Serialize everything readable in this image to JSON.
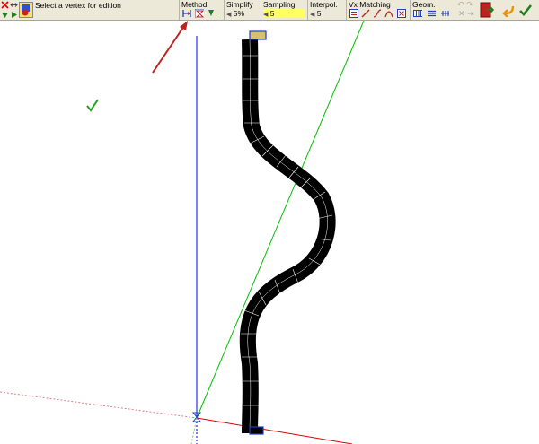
{
  "toolbar": {
    "status": "Select a vertex for edition",
    "method": {
      "title": "Method"
    },
    "simplify": {
      "title": "Simplify",
      "value": "5%"
    },
    "sampling": {
      "title": "Sampling",
      "value": "5"
    },
    "interpol": {
      "title": "Interpol.",
      "value": "5"
    },
    "vx_matching": {
      "title": "Vx Matching"
    },
    "geom": {
      "title": "Geom."
    }
  },
  "colors": {
    "toolbar_bg": "#ece9d8",
    "sampling_highlight": "#ffff66",
    "axis_blue": "#0000ff",
    "axis_green": "#00c000",
    "axis_red": "#e00000",
    "shape_fill": "#000000",
    "arrow_red": "#c02020",
    "check_green": "#20a020"
  },
  "icons": [
    "close-icon",
    "move-icon",
    "lasso-icon",
    "play-icon",
    "select-vertex-icon",
    "method-segment-icon",
    "method-hourglass-icon",
    "method-arrows-icon",
    "undo-icon",
    "redo-icon",
    "cancel-icon",
    "exit-icon",
    "back-icon",
    "validate-check-icon"
  ]
}
